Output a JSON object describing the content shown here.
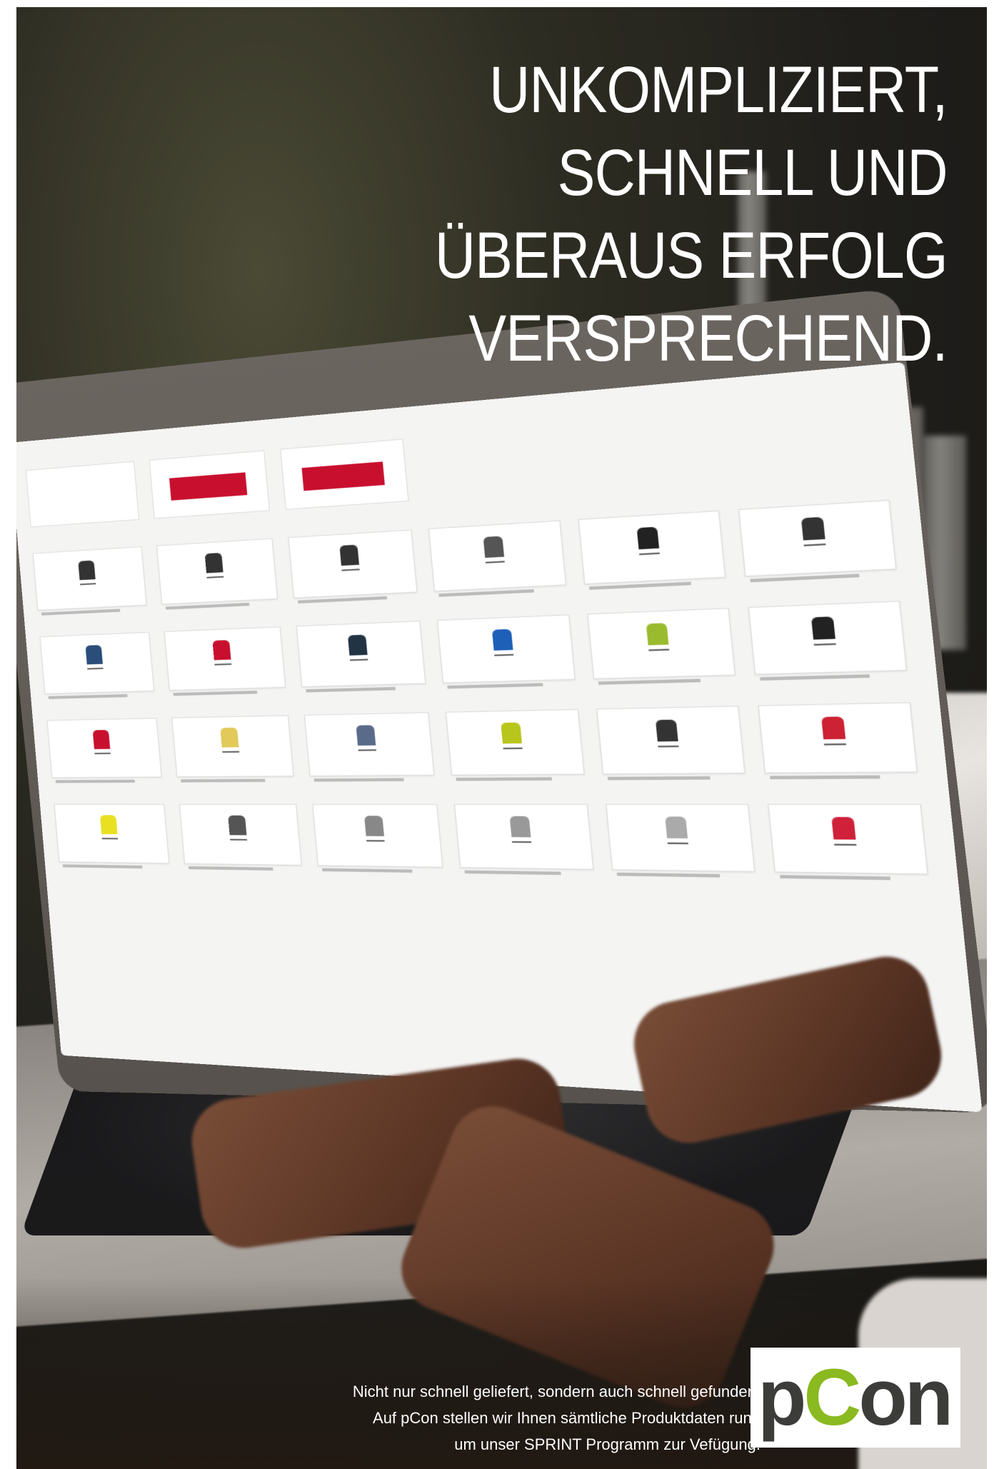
{
  "headline": {
    "line1": "UNKOMPLIZIERT,",
    "line2": "SCHNELL UND",
    "line3": "ÜBERAUS ERFOLG",
    "line4": "VERSPRECHEND."
  },
  "caption": {
    "line1": "Nicht nur schnell geliefert, sondern auch schnell gefunden.",
    "line2": "Auf pCon stellen wir Ihnen sämtliche Produktdaten rund",
    "line3": "um unser SPRINT Programm zur Vefügung."
  },
  "logo": {
    "text_p": "p",
    "text_c": "C",
    "text_on": "on"
  },
  "screen": {
    "chair_colors": [
      "#333333",
      "#333333",
      "#333333",
      "#555555",
      "#222222",
      "#333333",
      "#2a4d7a",
      "#c8102e",
      "#223344",
      "#1e5fb8",
      "#9bbb2e",
      "#222222",
      "#c8102e",
      "#e2c95a",
      "#5a6b8a",
      "#b8c51a",
      "#333333",
      "#cc2233",
      "#e8e020",
      "#555555",
      "#888888",
      "#999999",
      "#aaaaaa",
      "#d0203a"
    ]
  },
  "colors": {
    "brand_red": "#c8102e",
    "pcon_green": "#8ab920",
    "pcon_gray": "#3c3c3b"
  }
}
